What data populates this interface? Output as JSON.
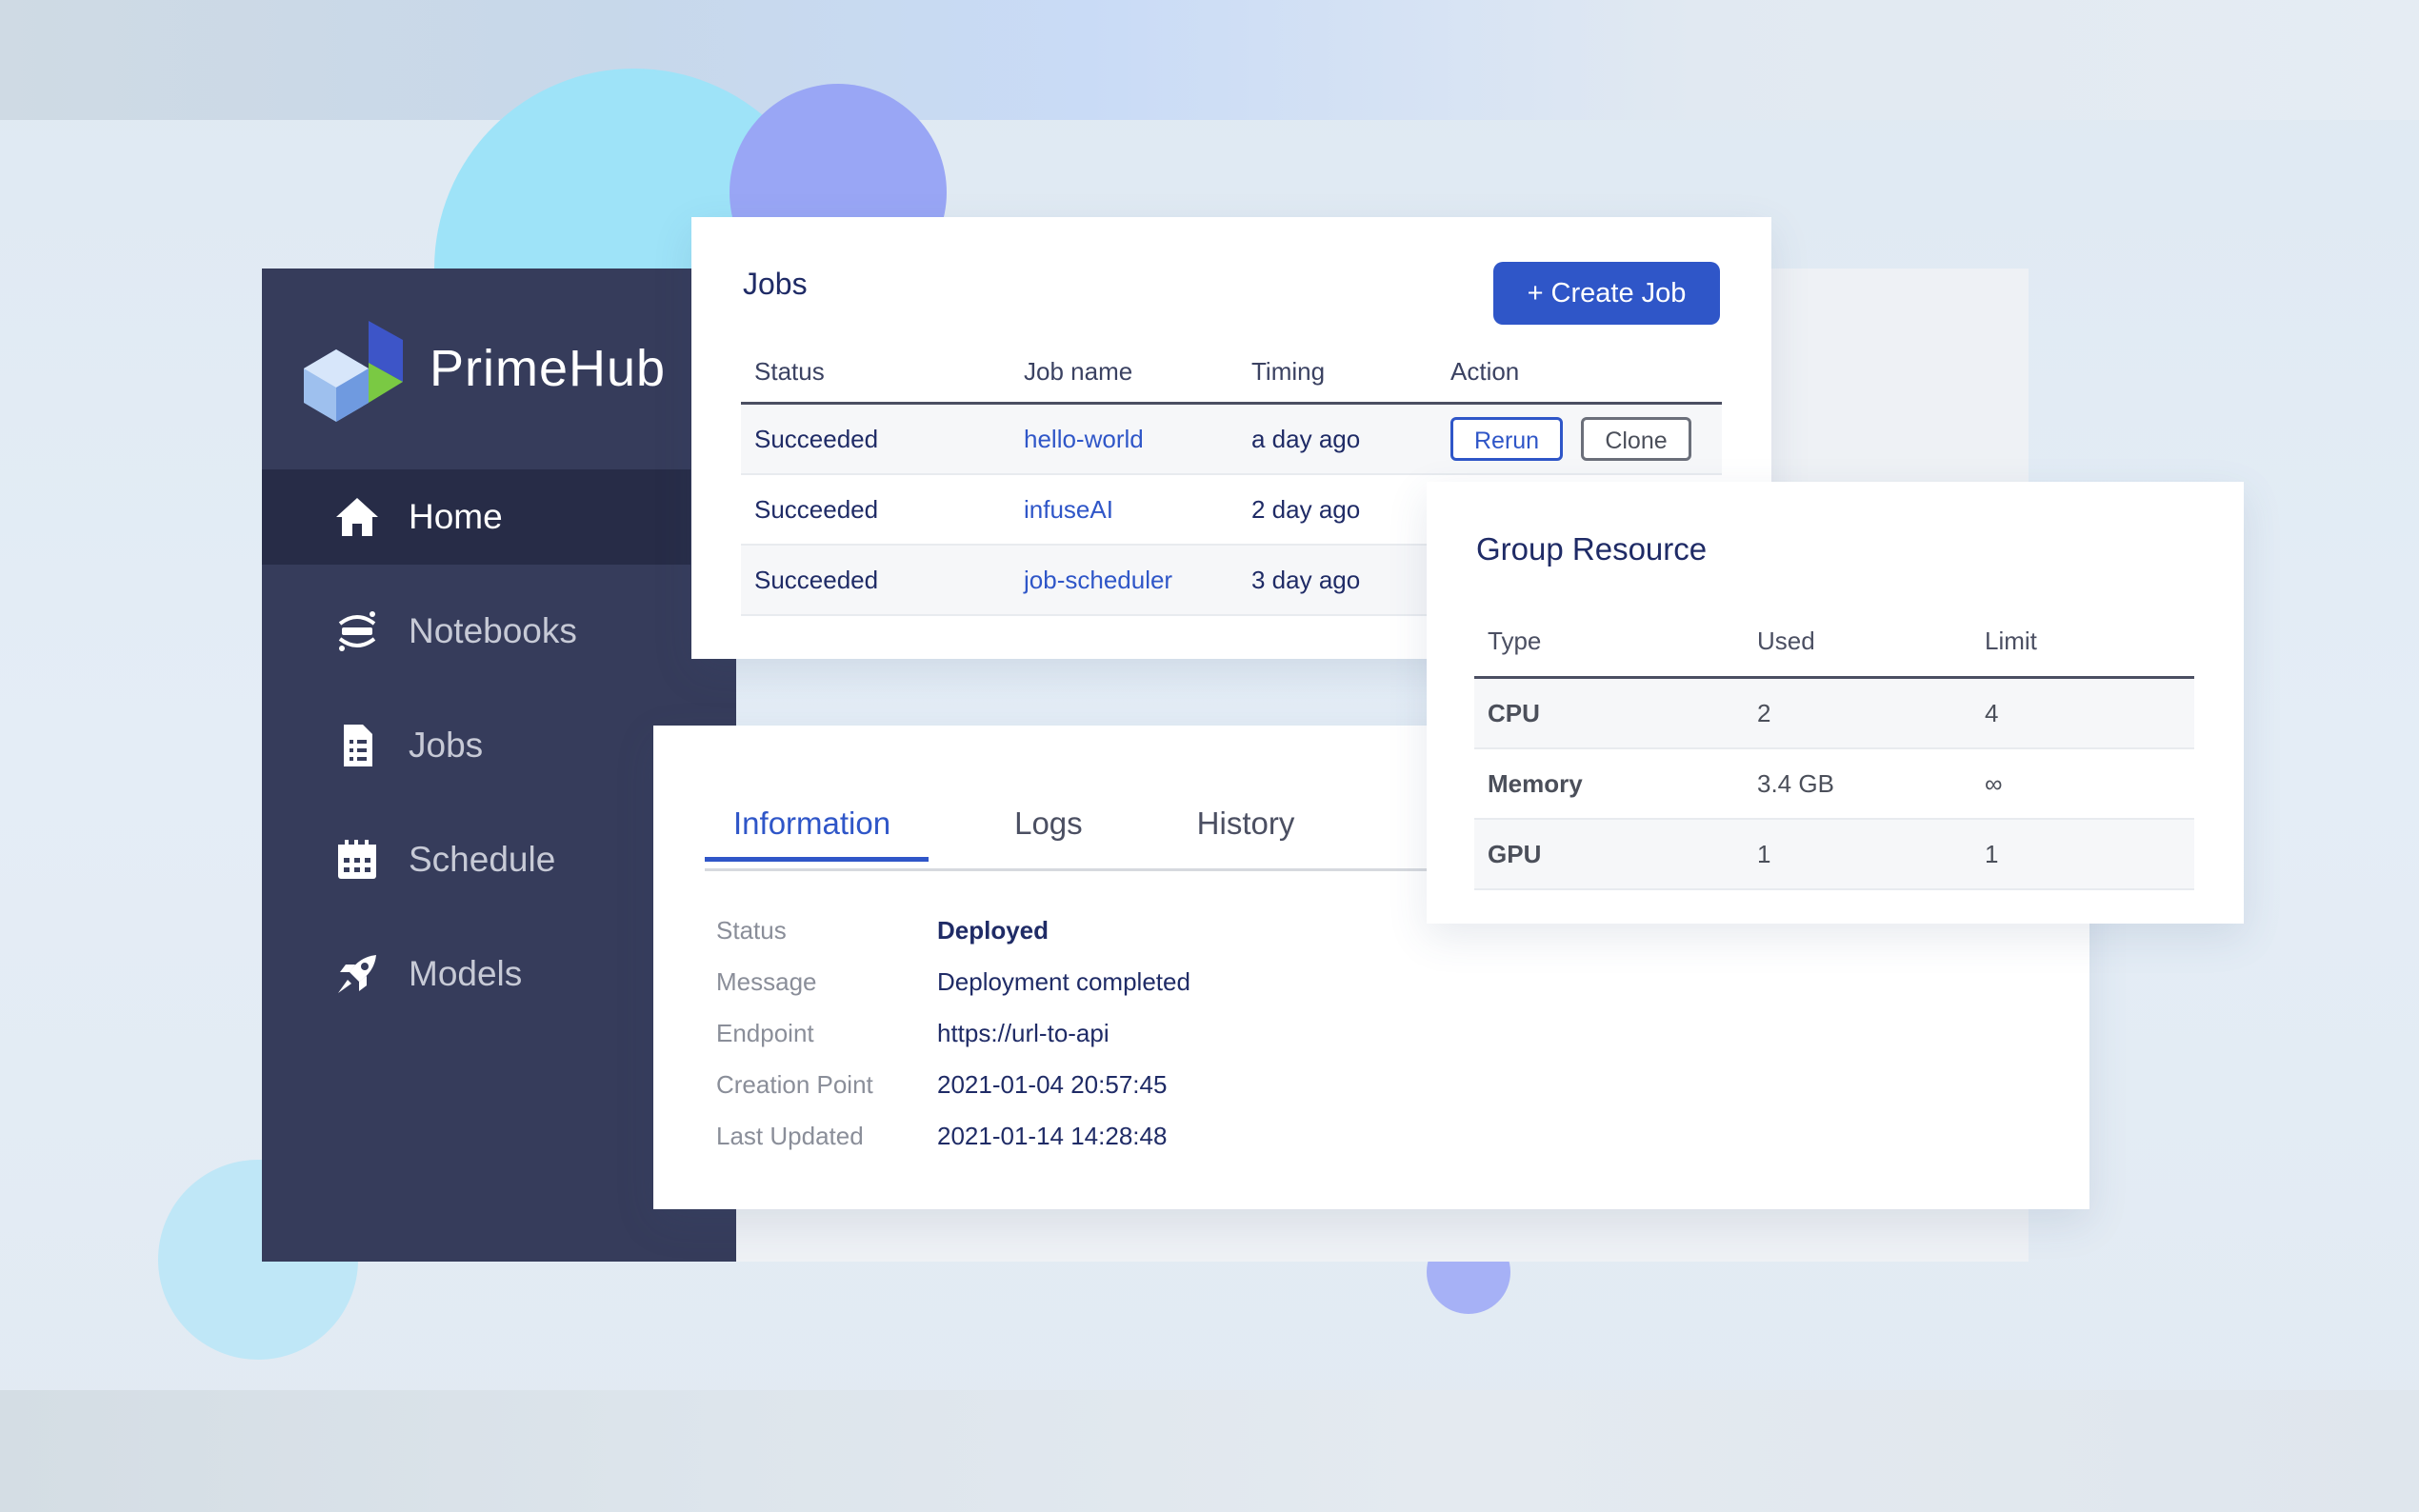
{
  "app": {
    "name": "PrimeHub"
  },
  "sidebar": {
    "items": [
      {
        "label": "Home",
        "icon": "home-icon",
        "active": true
      },
      {
        "label": "Notebooks",
        "icon": "jupyter-icon",
        "active": false
      },
      {
        "label": "Jobs",
        "icon": "document-icon",
        "active": false
      },
      {
        "label": "Schedule",
        "icon": "calendar-icon",
        "active": false
      },
      {
        "label": "Models",
        "icon": "rocket-icon",
        "active": false
      }
    ]
  },
  "jobs": {
    "title": "Jobs",
    "create_label": "+ Create Job",
    "columns": [
      "Status",
      "Job name",
      "Timing",
      "Action"
    ],
    "rows": [
      {
        "status": "Succeeded",
        "name": "hello-world",
        "timing": "a day ago",
        "rerun": "Rerun",
        "clone": "Clone"
      },
      {
        "status": "Succeeded",
        "name": "infuseAI",
        "timing": "2 day ago"
      },
      {
        "status": "Succeeded",
        "name": "job-scheduler",
        "timing": "3 day ago"
      }
    ]
  },
  "info": {
    "tabs": [
      "Information",
      "Logs",
      "History"
    ],
    "active_tab": "Information",
    "fields": [
      {
        "key": "Status",
        "value": "Deployed"
      },
      {
        "key": "Message",
        "value": "Deployment completed"
      },
      {
        "key": "Endpoint",
        "value": "https://url-to-api"
      },
      {
        "key": "Creation Point",
        "value": "2021-01-04 20:57:45"
      },
      {
        "key": "Last Updated",
        "value": "2021-01-14 14:28:48"
      }
    ]
  },
  "group": {
    "title": "Group Resource",
    "columns": [
      "Type",
      "Used",
      "Limit"
    ],
    "rows": [
      {
        "type": "CPU",
        "used": "2",
        "limit": "4"
      },
      {
        "type": "Memory",
        "used": "3.4 GB",
        "limit": "∞"
      },
      {
        "type": "GPU",
        "used": "1",
        "limit": "1"
      }
    ]
  },
  "colors": {
    "sidebar_bg": "#363c5b",
    "sidebar_active": "#272c47",
    "accent": "#2f56c8",
    "text_dark": "#1f2b66"
  }
}
